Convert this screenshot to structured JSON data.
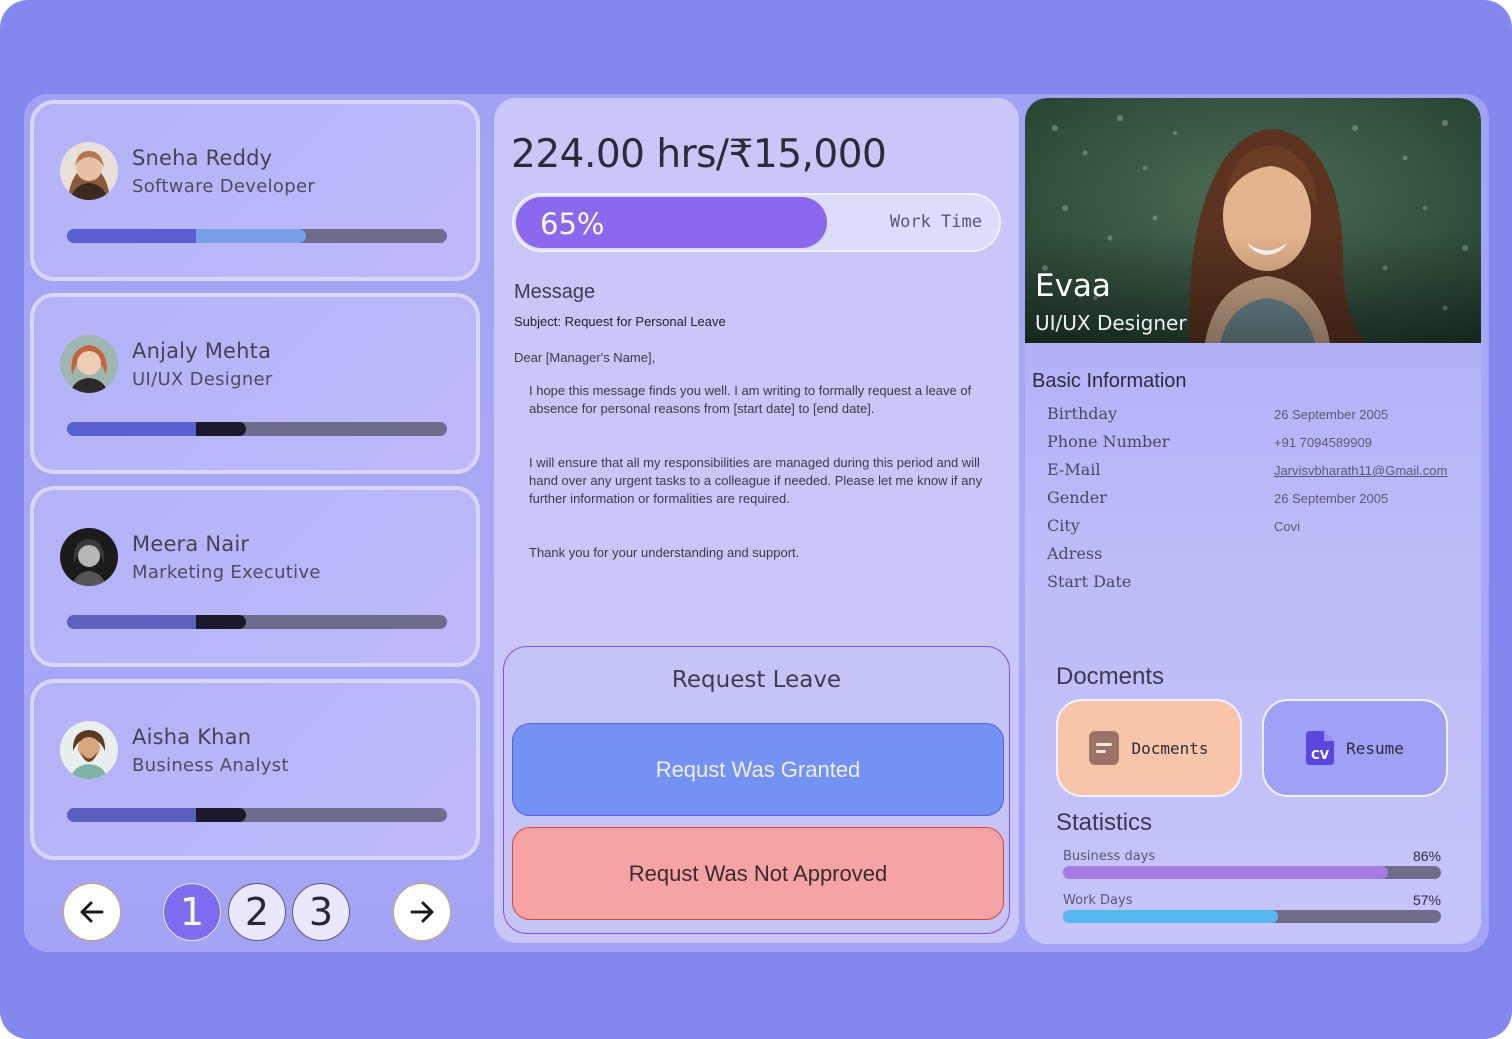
{
  "employees": [
    {
      "name": "Sneha Reddy",
      "role": "Software Developer",
      "progress": [
        0.34,
        0.63
      ],
      "colors": [
        "#5a5fd1",
        "#7a9fe6"
      ]
    },
    {
      "name": "Anjaly Mehta",
      "role": "UI/UX Designer",
      "progress": [
        0.34,
        0.47
      ],
      "colors": [
        "#5a5fd1",
        "#1b1a2c"
      ]
    },
    {
      "name": "Meera Nair",
      "role": "Marketing Executive",
      "progress": [
        0.34,
        0.47
      ],
      "colors": [
        "#5d62be",
        "#1b1a2c"
      ]
    },
    {
      "name": "Aisha Khan",
      "role": "Business Analyst",
      "progress": [
        0.34,
        0.47
      ],
      "colors": [
        "#5a5fc0",
        "#1b1a2c"
      ]
    }
  ],
  "pagination": {
    "prev_icon": "arrow-left-icon",
    "pages": [
      "1",
      "2",
      "3"
    ],
    "active_page": "1",
    "next_icon": "arrow-right-icon"
  },
  "work": {
    "hours_text": "224.00 hrs/₹15,000",
    "progress_value": 0.65,
    "progress_text": "65%",
    "progress_label": "Work Time",
    "accent": "#8a69ef"
  },
  "message": {
    "title": "Message",
    "subject": "Subject: Request for Personal Leave",
    "greeting": "Dear [Manager's Name],",
    "paragraphs": [
      "I hope this message finds you well. I am writing to formally request a leave of absence for personal reasons from [start date] to [end date].",
      "I will ensure that all my responsibilities are managed during this period and will hand over any urgent tasks to a colleague if needed. Please let me know if any further information or formalities are required.",
      "Thank you for your understanding and support."
    ]
  },
  "leave": {
    "title": "Request Leave",
    "granted_label": "Requst  Was Granted",
    "rejected_label": "Requst  Was Not Approved",
    "granted_color": "#7491f4",
    "rejected_color": "#f6a3a5"
  },
  "profile": {
    "name": "Evaa",
    "role": "UI/UX Designer",
    "basic_title": "Basic Information",
    "fields": [
      {
        "label": "Birthday",
        "value": "26 September 2005"
      },
      {
        "label": "Phone Number",
        "value": "+91 7094589909"
      },
      {
        "label": "E-Mail",
        "value": "Jarvisvbharath11@Gmail.com"
      },
      {
        "label": "Gender",
        "value": "26 September 2005"
      },
      {
        "label": "City",
        "value": "Covi"
      },
      {
        "label": "Adress",
        "value": ""
      },
      {
        "label": "Start Date",
        "value": ""
      }
    ],
    "documents_title": "Docments",
    "documents": [
      {
        "label": "Docments",
        "icon": "document-icon",
        "color": "#f8c4aa"
      },
      {
        "label": "Resume",
        "icon": "cv-file-icon",
        "color": "#9fa0f6"
      }
    ],
    "statistics_title": "Statistics",
    "stats": [
      {
        "label": "Business days",
        "value": 0.86,
        "text": "86%",
        "color": "#a67be3"
      },
      {
        "label": "Work Days",
        "value": 0.57,
        "text": "57%",
        "color": "#56b8ee"
      }
    ]
  }
}
